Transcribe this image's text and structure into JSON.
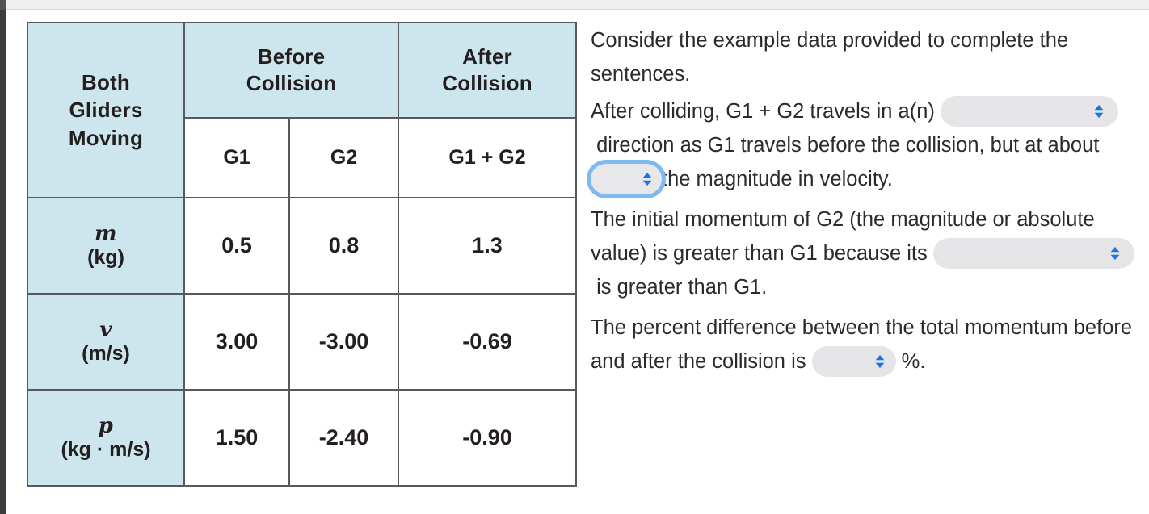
{
  "window": {
    "top_bar_color": "#efefef",
    "rail_color": "#3c3c3c"
  },
  "table": {
    "corner_label": "Both Gliders Moving",
    "corner_label_lines": [
      "Both",
      "Gliders",
      "Moving"
    ],
    "group_headers": [
      {
        "label": "Before Collision",
        "lines": [
          "Before",
          "Collision"
        ],
        "span": 2
      },
      {
        "label": "After Collision",
        "lines": [
          "After",
          "Collision"
        ],
        "span": 1
      }
    ],
    "sub_headers": [
      "G1",
      "G2",
      "G1 + G2"
    ],
    "header_bg": "#cde5ec",
    "border_color": "#58595b",
    "rows": [
      {
        "symbol": "m",
        "unit": "(kg)",
        "values": [
          "0.5",
          "0.8",
          "1.3"
        ]
      },
      {
        "symbol": "v",
        "unit": "(m/s)",
        "values": [
          "3.00",
          "-3.00",
          "-0.69"
        ]
      },
      {
        "symbol": "p",
        "unit": "(kg · m/s)",
        "values": [
          "1.50",
          "-2.40",
          "-0.90"
        ]
      }
    ]
  },
  "panel": {
    "instruction": "Consider the example data provided to complete the sentences.",
    "sentence1": {
      "part1": "After colliding, G1 + G2 travels in a(n)",
      "part2": "direction as G1 travels before the collision, but at about",
      "part3": "the magnitude in velocity."
    },
    "sentence2": {
      "part1": "The initial momentum of G2 (the magnitude or absolute value) is greater than G1 because its",
      "part2": "is greater than G1."
    },
    "sentence3": {
      "part1": "The percent difference between the total momentum before and after the collision is",
      "part2": "%."
    },
    "dropdowns": [
      {
        "name": "direction-select",
        "value": "",
        "focused": false
      },
      {
        "name": "magnitude-select",
        "value": "",
        "focused": true
      },
      {
        "name": "quantity-select",
        "value": "",
        "focused": false
      },
      {
        "name": "percent-select",
        "value": "",
        "focused": false
      }
    ],
    "chevron_color": "#1a73e8",
    "pill_bg": "#e5e5e7",
    "focus_ring_color": "#7fb9f2"
  }
}
